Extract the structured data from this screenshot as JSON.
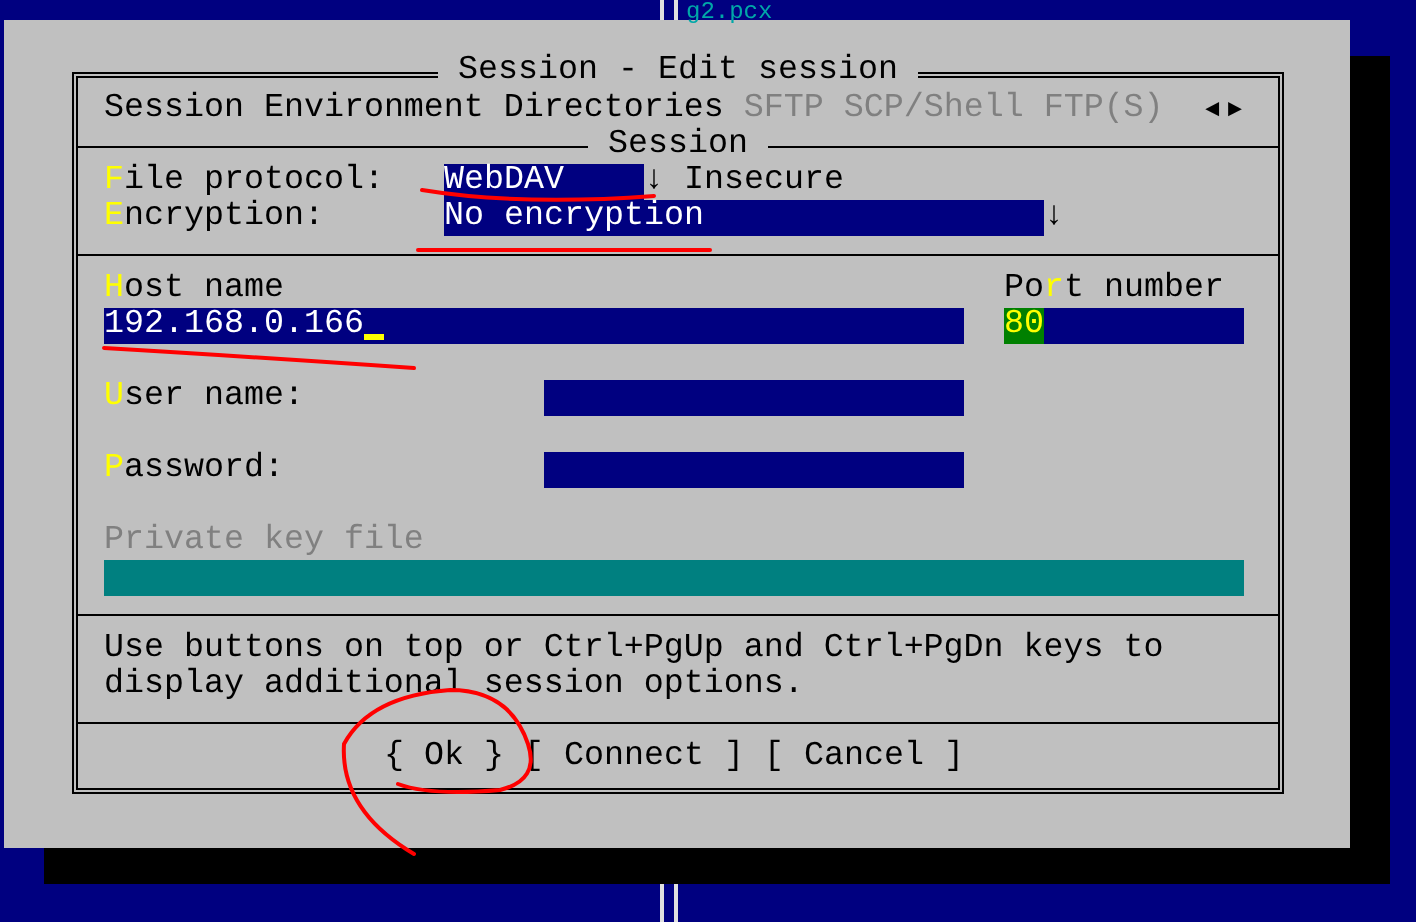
{
  "background_panel": {
    "file_name": "g2.pcx"
  },
  "dialog": {
    "title": "Session - Edit session",
    "tabs": [
      {
        "label": "Session",
        "disabled": false
      },
      {
        "label": "Environment",
        "disabled": false
      },
      {
        "label": "Directories",
        "disabled": false
      },
      {
        "label": "SFTP",
        "disabled": true
      },
      {
        "label": "SCP/Shell",
        "disabled": true
      },
      {
        "label": "FTP(S)",
        "disabled": true
      }
    ],
    "tab_scroll": [
      "◄",
      "►"
    ],
    "group_title": "Session",
    "protocol_rows": [
      {
        "label": [
          {
            "text": "F",
            "hotkey": true
          },
          {
            "text": "ile protocol:",
            "hotkey": false
          }
        ],
        "value": "WebDAV",
        "arrow": "↓",
        "note": "Insecure",
        "wide": false
      },
      {
        "label": [
          {
            "text": "E",
            "hotkey": true
          },
          {
            "text": "ncryption:",
            "hotkey": false
          }
        ],
        "value": "No encryption",
        "arrow": "↓",
        "wide": true
      }
    ],
    "host": {
      "label": [
        {
          "text": "H",
          "hotkey": true
        },
        {
          "text": "ost name",
          "hotkey": false
        }
      ],
      "value": "192.168.0.166",
      "focused": true
    },
    "port": {
      "label": [
        {
          "text": "Po",
          "hotkey": false
        },
        {
          "text": "r",
          "hotkey": true
        },
        {
          "text": "t number",
          "hotkey": false
        }
      ],
      "value": "80",
      "value_selected": true
    },
    "credentials": [
      {
        "label": [
          {
            "text": "U",
            "hotkey": true
          },
          {
            "text": "ser name:",
            "hotkey": false
          }
        ]
      },
      {
        "label": [
          {
            "text": "P",
            "hotkey": true
          },
          {
            "text": "assword:",
            "hotkey": false
          }
        ]
      }
    ],
    "private_key": {
      "label": "Private key file",
      "disabled": true
    },
    "hint": "Use buttons on top or Ctrl+PgUp and Ctrl+PgDn keys to display additional session options.",
    "buttons": [
      {
        "label": "{ Ok }"
      },
      {
        "label": "[ Connect ]"
      },
      {
        "label": "[ Cancel ]"
      }
    ]
  }
}
